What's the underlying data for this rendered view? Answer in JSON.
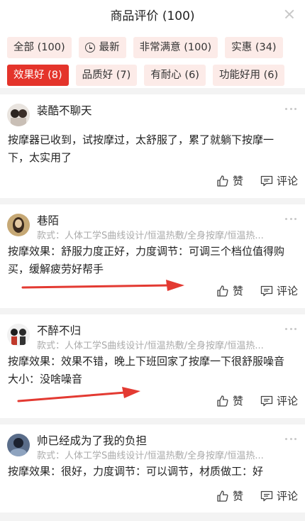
{
  "header": {
    "title": "商品评价 (100)"
  },
  "filters": {
    "row1": [
      {
        "label": "全部 (100)",
        "active": false
      },
      {
        "label": "最新",
        "active": false,
        "icon": "clock-icon"
      },
      {
        "label": "非常满意 (100)",
        "active": false
      },
      {
        "label": "实惠 (34)",
        "active": false
      }
    ],
    "row2": [
      {
        "label": "效果好 (8)",
        "active": true
      },
      {
        "label": "品质好 (7)",
        "active": false
      },
      {
        "label": "有耐心 (6)",
        "active": false
      },
      {
        "label": "功能好用 (6)",
        "active": false
      }
    ]
  },
  "colors": {
    "accent": "#e4342b",
    "chip_bg": "#fcebe8",
    "muted": "#aaaaaa",
    "divider": "#f3f3f3"
  },
  "reviews": [
    {
      "username": "装酷不聊天",
      "spec": "",
      "content_lines": [
        "按摩器已收到，试按摩过，太舒服了，累了就躺下按摩一",
        "下，太实用了"
      ],
      "like_label": "赞",
      "comment_label": "评论"
    },
    {
      "username": "巷陌",
      "spec": "款式：人体工学S曲线设计/恒温热敷/全身按摩/恒温热...",
      "content_lines": [
        "按摩效果：舒服力度正好，力度调节：可调三个档位值得购",
        "买，缓解疲劳好帮手"
      ],
      "like_label": "赞",
      "comment_label": "评论"
    },
    {
      "username": "不醉不归",
      "spec": "款式：人体工学S曲线设计/恒温热敷/全身按摩/恒温热...",
      "content_lines": [
        "按摩效果：效果不错，晚上下班回家了按摩一下很舒服噪音",
        "大小：没啥噪音"
      ],
      "like_label": "赞",
      "comment_label": "评论"
    },
    {
      "username": "帅已经成为了我的负担",
      "spec": "款式：人体工学S曲线设计/恒温热敷/全身按摩/恒温热...",
      "content_lines": [
        "按摩效果：很好，力度调节：可以调节，材质做工：好"
      ],
      "like_label": "赞",
      "comment_label": "评论"
    }
  ],
  "review0_spec_line": "款式：人体工学S曲线设计/恒温热敷/全身按摩/恒温热..."
}
